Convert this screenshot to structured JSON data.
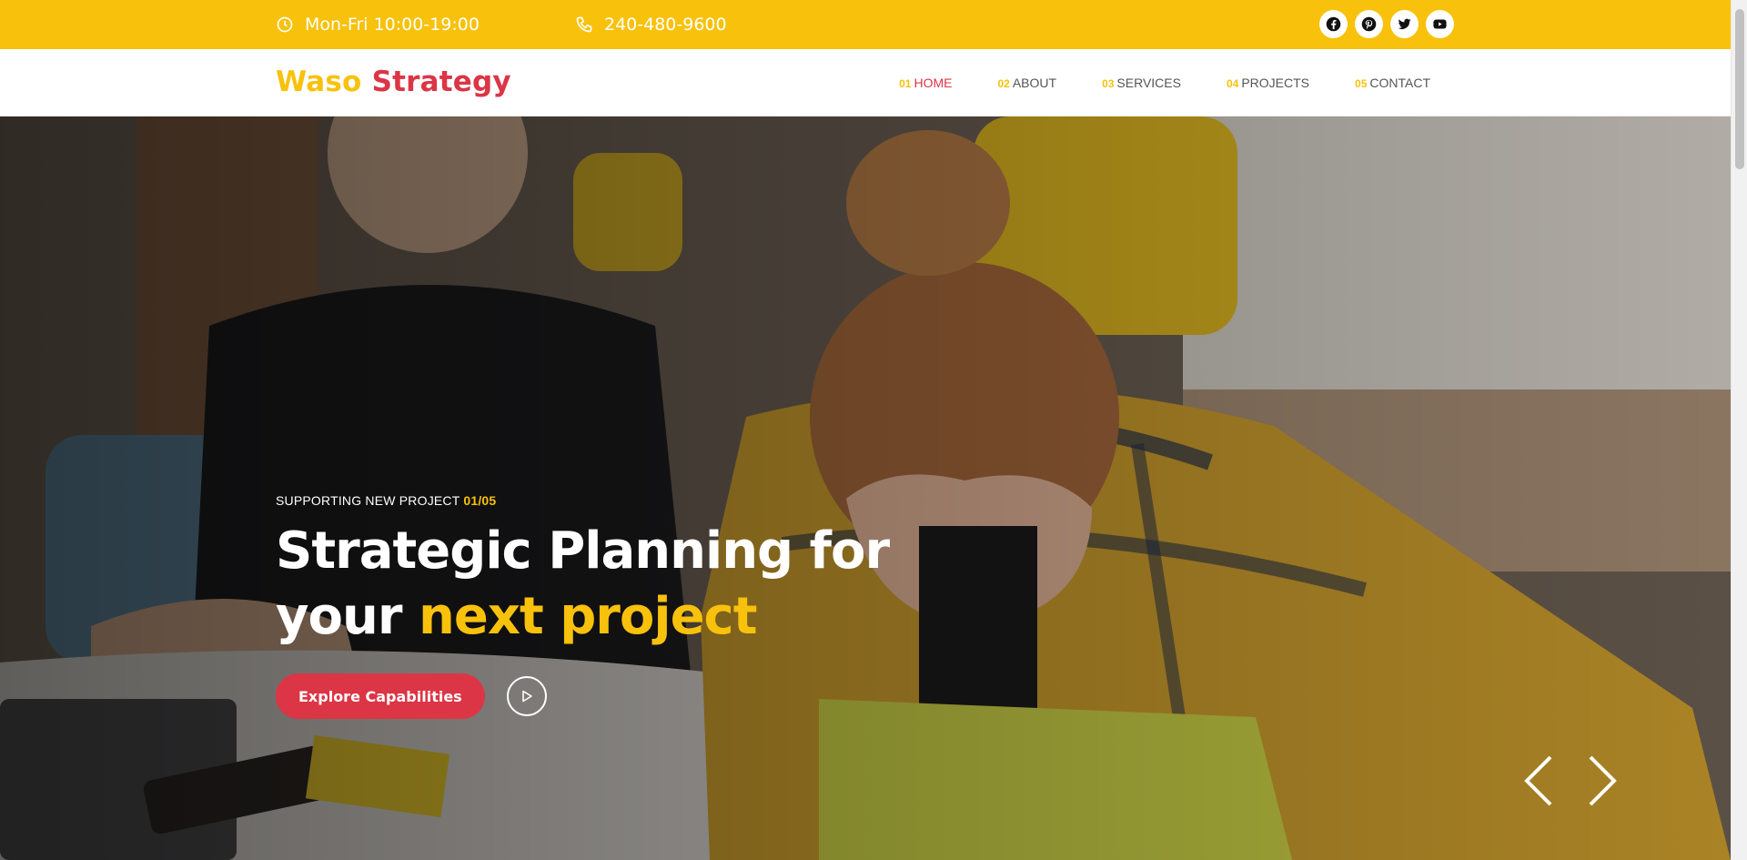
{
  "topbar": {
    "hours": "Mon-Fri 10:00-19:00",
    "phone": "240-480-9600",
    "social": [
      "facebook-icon",
      "pinterest-icon",
      "twitter-icon",
      "youtube-icon"
    ]
  },
  "header": {
    "logo_part1": "Waso",
    "logo_part2": "Strategy",
    "nav": [
      {
        "num": "01",
        "label": "HOME",
        "active": true
      },
      {
        "num": "02",
        "label": "ABOUT"
      },
      {
        "num": "03",
        "label": "SERVICES"
      },
      {
        "num": "04",
        "label": "PROJECTS"
      },
      {
        "num": "05",
        "label": "CONTACT"
      }
    ]
  },
  "hero": {
    "eyebrow": "SUPPORTING NEW PROJECT",
    "eyebrow_count": "01/05",
    "headline_line1": "Strategic Planning for",
    "headline_line2_a": "your",
    "headline_line2_b": "next project",
    "cta_label": "Explore Capabilities",
    "play_icon": "play-icon",
    "prev_icon": "chevron-left-icon",
    "next_icon": "chevron-right-icon"
  },
  "colors": {
    "accent_yellow": "#f8c10c",
    "accent_red": "#dc3545"
  }
}
